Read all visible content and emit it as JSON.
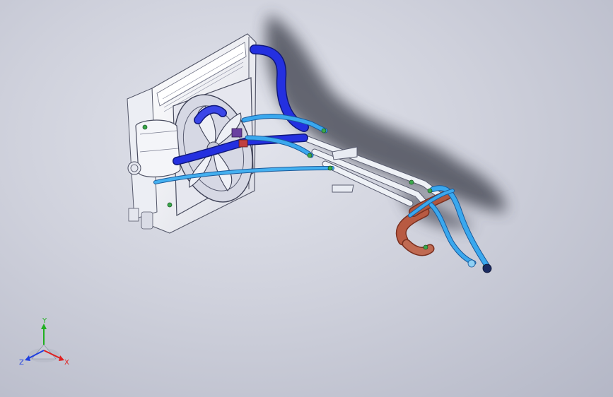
{
  "viewport": {
    "background_top": "#e2e4ec",
    "background_bottom": "#b4b7c6"
  },
  "model": {
    "parts": [
      {
        "name": "radiator-core",
        "icon": "radiator-icon"
      },
      {
        "name": "cooling-fan",
        "icon": "fan-icon"
      },
      {
        "name": "expansion-tank",
        "icon": "tank-icon"
      },
      {
        "name": "coolant-hoses",
        "icon": "hose-icon"
      }
    ],
    "colors": {
      "hose_dark": "#1f2fd8",
      "hose_light": "#2f9be8",
      "hose_rubber": "#b35c46",
      "pipe_metal": "#e8ecf2",
      "radiator": "#f2f2f6",
      "clamp": "#39a84a"
    }
  },
  "triad": {
    "x_label": "X",
    "y_label": "Y",
    "z_label": "Z",
    "x_color": "#e02020",
    "y_color": "#20b020",
    "z_color": "#2040e0"
  }
}
